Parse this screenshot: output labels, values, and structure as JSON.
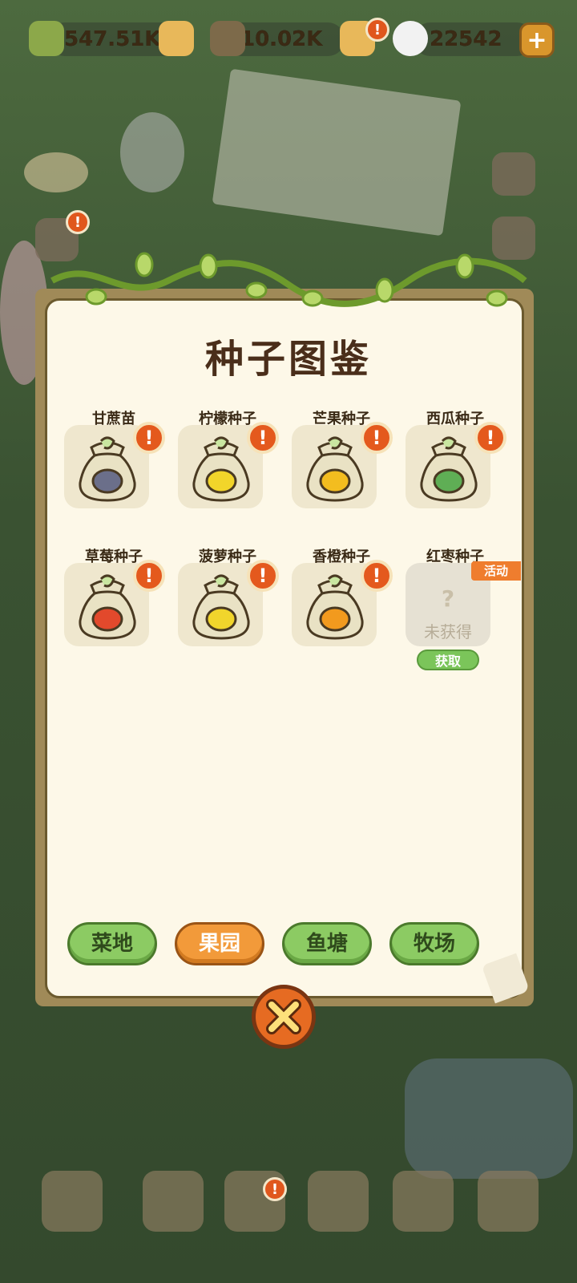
{
  "resources": {
    "bamboo": "547.51K",
    "shoots": "10.02K",
    "panda_coins": "22542"
  },
  "modal": {
    "title": "种子图鉴"
  },
  "items": [
    {
      "name": "甘蔗苗",
      "fruit": "sugarcane",
      "color": "#6b6f8a",
      "alert": "!"
    },
    {
      "name": "柠檬种子",
      "fruit": "lemon",
      "color": "#f2d52a",
      "alert": "!"
    },
    {
      "name": "芒果种子",
      "fruit": "mango",
      "color": "#f3bd1f",
      "alert": "!"
    },
    {
      "name": "西瓜种子",
      "fruit": "watermelon",
      "color": "#5fae55",
      "alert": "!"
    },
    {
      "name": "草莓种子",
      "fruit": "strawberry",
      "color": "#e2492c",
      "alert": "!"
    },
    {
      "name": "菠萝种子",
      "fruit": "pineapple",
      "color": "#f1d52c",
      "alert": "!"
    },
    {
      "name": "香橙种子",
      "fruit": "orange",
      "color": "#f29a1e",
      "alert": "!"
    },
    {
      "name": "红枣种子",
      "fruit": "jujube",
      "color": "#cfc6b0",
      "locked": true,
      "locked_label": "未获得",
      "event_tag": "活动",
      "get_label": "获取",
      "qmark": "?"
    }
  ],
  "tabs": [
    {
      "label": "菜地",
      "active": false
    },
    {
      "label": "果园",
      "active": true
    },
    {
      "label": "鱼塘",
      "active": false
    },
    {
      "label": "牧场",
      "active": false
    }
  ],
  "colors": {
    "accent": "#f29a3a",
    "tab_green": "#8ccb63",
    "alert": "#e4591d"
  }
}
